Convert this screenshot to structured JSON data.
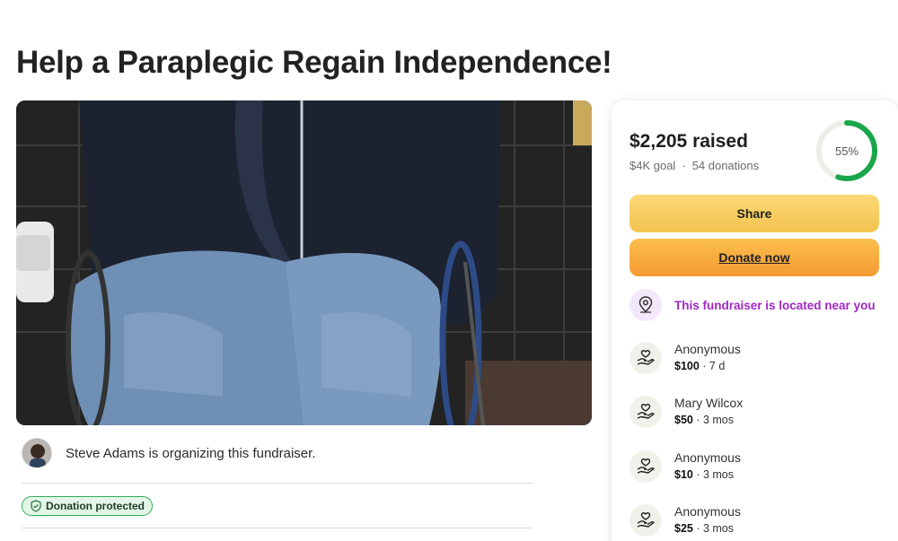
{
  "page": {
    "title": "Help a Paraplegic Regain Independence!"
  },
  "hero": {
    "image_description_icon": "photo-of-person-in-wheelchair"
  },
  "organizer": {
    "text": "Steve Adams is organizing this fundraiser."
  },
  "badge": {
    "label": "Donation protected",
    "icon": "shield-icon"
  },
  "progress": {
    "raised": "$2,205 raised",
    "goal": "$4K goal",
    "separator": "·",
    "donations": "54 donations",
    "percent_label": "55%",
    "percent_value": 0.55
  },
  "buttons": {
    "share": "Share",
    "donate": "Donate now"
  },
  "nearby": {
    "text": "This fundraiser is located near you",
    "icon": "location-pin-icon"
  },
  "donations": [
    {
      "name": "Anonymous",
      "amount": "$100",
      "time": "7 d"
    },
    {
      "name": "Mary Wilcox",
      "amount": "$50",
      "time": "3 mos"
    },
    {
      "name": "Anonymous",
      "amount": "$10",
      "time": "3 mos"
    },
    {
      "name": "Anonymous",
      "amount": "$25",
      "time": "3 mos"
    }
  ],
  "colors": {
    "accent_green": "#1aa64a",
    "share_yellow": "#f6cb5c",
    "donate_orange": "#f7a83a",
    "nearby_purple": "#a128c6"
  }
}
